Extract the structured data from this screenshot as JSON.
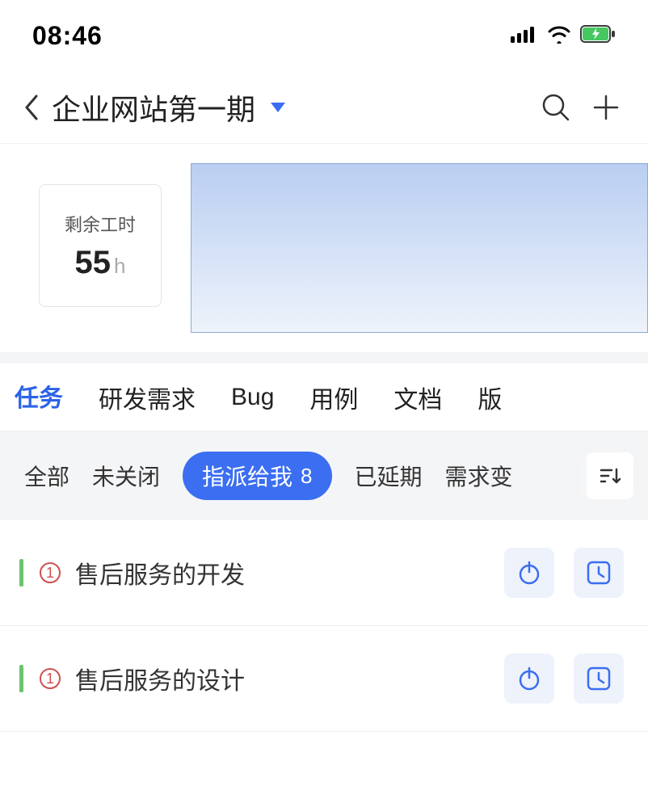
{
  "status": {
    "time": "08:46"
  },
  "header": {
    "title": "企业网站第一期"
  },
  "hours": {
    "label": "剩余工时",
    "value": "55",
    "unit": "h"
  },
  "tabs": [
    "任务",
    "研发需求",
    "Bug",
    "用例",
    "文档",
    "版"
  ],
  "active_tab_index": 0,
  "filters": {
    "items": [
      "全部",
      "未关闭",
      "指派给我",
      "已延期",
      "需求变"
    ],
    "active_index": 2,
    "active_count": "8"
  },
  "tasks": [
    {
      "priority": "1",
      "title": "售后服务的开发"
    },
    {
      "priority": "1",
      "title": "售后服务的设计"
    }
  ]
}
